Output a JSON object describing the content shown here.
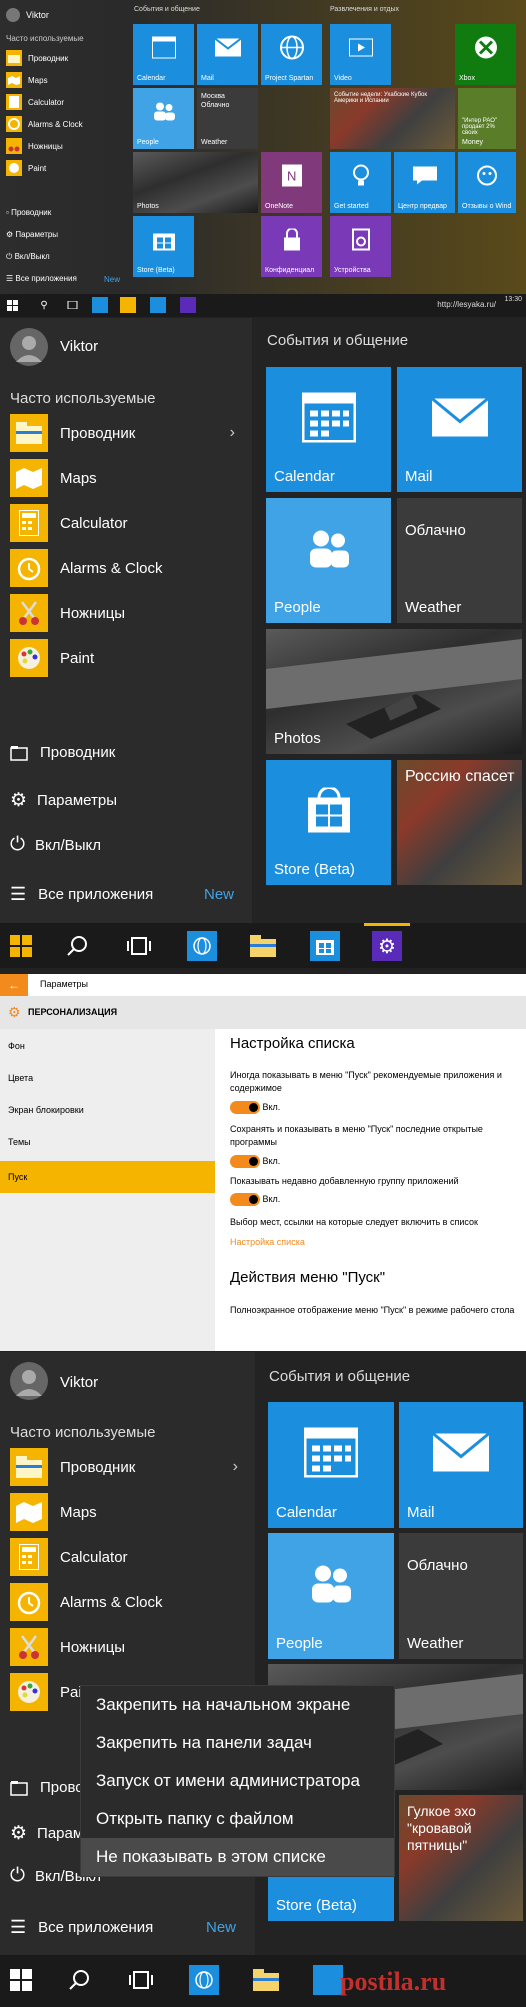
{
  "colors": {
    "accent": "#f4b400",
    "tile_blue": "#1b8fde",
    "settings_orange": "#f28a1c",
    "selected_nav": "#f4b400"
  },
  "panel1": {
    "user": "Viktor",
    "frequent_title": "Часто используемые",
    "apps": [
      {
        "label": "Проводник",
        "icon": "folder-icon"
      },
      {
        "label": "Maps",
        "icon": "maps-icon"
      },
      {
        "label": "Calculator",
        "icon": "calculator-icon"
      },
      {
        "label": "Alarms & Clock",
        "icon": "alarm-icon"
      },
      {
        "label": "Ножницы",
        "icon": "scissors-icon"
      },
      {
        "label": "Paint",
        "icon": "paint-icon"
      }
    ],
    "bottom": [
      {
        "label": "Проводник",
        "icon": "explorer-icon"
      },
      {
        "label": "Параметры",
        "icon": "gear-icon"
      },
      {
        "label": "Вкл/Выкл",
        "icon": "power-icon"
      },
      {
        "label": "Все приложения",
        "icon": "list-icon"
      }
    ],
    "new_label": "New",
    "group1": "События и общение",
    "group2": "Развлечения и отдых",
    "tiles": {
      "calendar": "Calendar",
      "mail": "Mail",
      "spartan": "Project Spartan",
      "video": "Video",
      "xbox": "Xbox",
      "people": "People",
      "weather_city": "Москва",
      "weather_cond": "Облачно",
      "weather": "Weather",
      "news": "Событие недели: Ухабские Кубок Америки и Испании",
      "money_text": "\"Интер РАО\" продает 2% своих",
      "money": "Money",
      "photos": "Photos",
      "onenote": "OneNote",
      "getstarted": "Get started",
      "center": "Центр предвар",
      "feedback": "Отзывы о Wind",
      "store": "Store (Beta)",
      "privacy": "Конфиденциал",
      "devices": "Устройства"
    },
    "clock": "13:30",
    "watermark": "http://lesyaka.ru/"
  },
  "panel2": {
    "user": "Viktor",
    "frequent_title": "Часто используемые",
    "apps": [
      "Проводник",
      "Maps",
      "Calculator",
      "Alarms & Clock",
      "Ножницы",
      "Paint"
    ],
    "bottom": [
      "Проводник",
      "Параметры",
      "Вкл/Выкл",
      "Все приложения"
    ],
    "new_label": "New",
    "group": "События и общение",
    "tiles": {
      "calendar": "Calendar",
      "mail": "Mail",
      "people": "People",
      "weather_cond": "Облачно",
      "weather": "Weather",
      "photos": "Photos",
      "store": "Store (Beta)",
      "news": "Россию спасет"
    }
  },
  "settings": {
    "window_title": "Параметры",
    "section_title": "ПЕРСОНАЛИЗАЦИЯ",
    "nav": [
      "Фон",
      "Цвета",
      "Экран блокировки",
      "Темы",
      "Пуск"
    ],
    "selected": "Пуск",
    "h1": "Настройка списка",
    "opt1": "Иногда показывать в меню \"Пуск\" рекомендуемые приложения и содержимое",
    "opt2": "Сохранять и показывать в меню \"Пуск\" последние открытые программы",
    "opt3": "Показывать недавно добавленную группу приложений",
    "toggle_on": "Вкл.",
    "pick_text": "Выбор мест, ссылки на которые следует включить в список",
    "pick_link": "Настройка списка",
    "h2": "Действия меню \"Пуск\"",
    "fullscreen": "Полноэкранное отображение меню \"Пуск\" в режиме рабочего стола"
  },
  "panel3": {
    "user": "Viktor",
    "frequent_title": "Часто используемые",
    "apps": [
      "Проводник",
      "Maps",
      "Calculator",
      "Alarms & Clock",
      "Ножницы",
      "Paint"
    ],
    "bottom": [
      "Проводник",
      "Параметры",
      "Вкл/Выкл",
      "Все приложения"
    ],
    "bottom_cut": [
      "Прово",
      "Парам"
    ],
    "paint_cut": "Pai",
    "new_label": "New",
    "group": "События и общение",
    "tiles": {
      "calendar": "Calendar",
      "mail": "Mail",
      "people": "People",
      "weather_cond": "Облачно",
      "weather": "Weather",
      "store": "Store (Beta)",
      "news": "Гулкое эхо \"кровавой пятницы\""
    },
    "context_menu": [
      "Закрепить на начальном экране",
      "Закрепить на панели задач",
      "Запуск от имени администратора",
      "Открыть папку с файлом",
      "Не показывать в этом списке"
    ],
    "watermark": "postila.ru"
  }
}
